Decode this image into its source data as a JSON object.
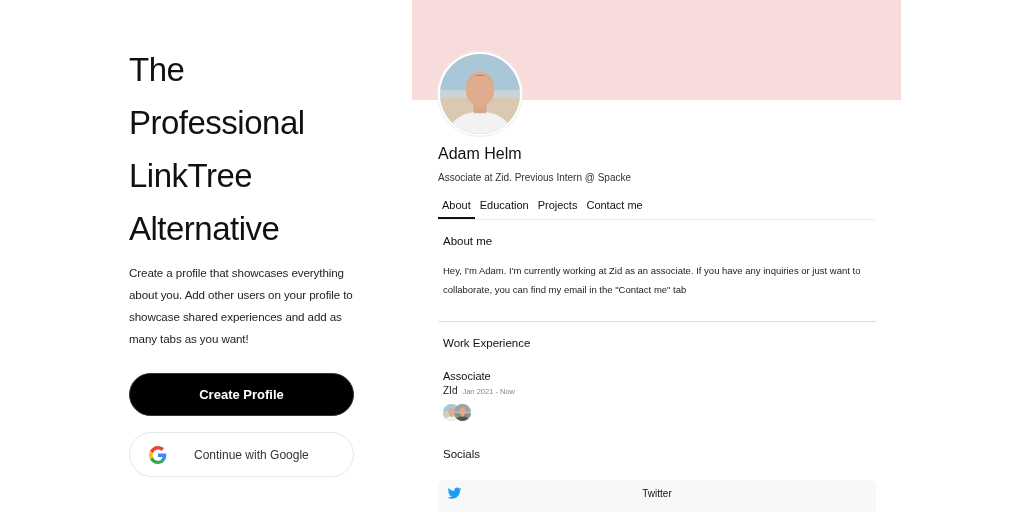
{
  "hero": {
    "heading_lines": [
      "The",
      "Professional",
      "LinkTree",
      "Alternative"
    ],
    "description": "Create a profile that showcases everything about you. Add other users on your profile to showcase shared experiences and add as many tabs as you want!",
    "primary_button": "Create Profile",
    "google_button": "Continue with Google"
  },
  "profile": {
    "name": "Adam Helm",
    "headline": "Associate at Zid. Previous Intern @ Spacke",
    "tabs": [
      {
        "label": "About",
        "selected": true
      },
      {
        "label": "Education",
        "selected": false
      },
      {
        "label": "Projects",
        "selected": false
      },
      {
        "label": "Contact me",
        "selected": false
      }
    ],
    "about": {
      "title": "About me",
      "text": "Hey, I'm Adam. I'm currently working at Zid as an associate. If you have any inquiries or just want to collaborate, you can find  my email in the \"Contact me\" tab"
    },
    "work": {
      "title": "Work Experience",
      "items": [
        {
          "role": "Associate",
          "company": "ZId",
          "dates": "Jan 2021 - Now"
        }
      ]
    },
    "socials": {
      "title": "Socials",
      "links": [
        {
          "kind": "twitter",
          "label": "Twitter"
        }
      ]
    }
  }
}
